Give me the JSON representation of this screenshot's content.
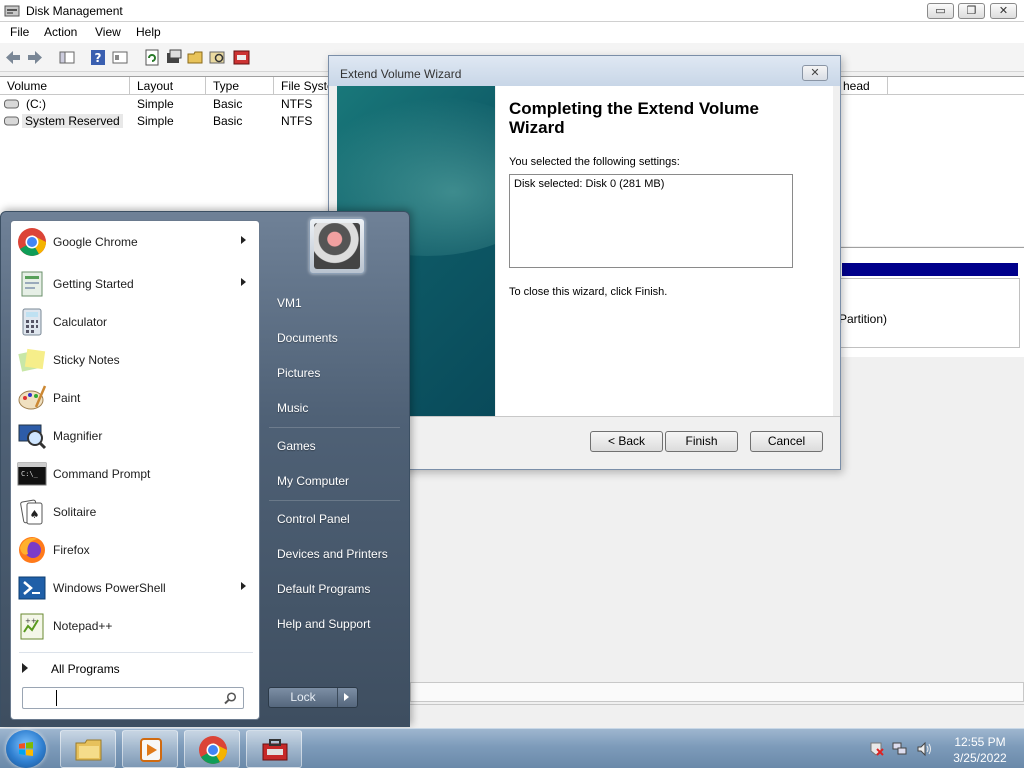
{
  "disk_management": {
    "title": "Disk Management",
    "window_controls": {
      "minimize": "▭",
      "maximize": "❐",
      "close": "✕"
    },
    "menu": [
      "File",
      "Action",
      "View",
      "Help"
    ],
    "columns": [
      "Volume",
      "Layout",
      "Type",
      "File Syste",
      "head"
    ],
    "volumes": [
      {
        "volume": "(C:)",
        "layout": "Simple",
        "type": "Basic",
        "fs": "NTFS"
      },
      {
        "volume": "System Reserved",
        "layout": "Simple",
        "type": "Basic",
        "fs": "NTFS"
      }
    ],
    "partition_label": "Partition)"
  },
  "wizard": {
    "title": "Extend Volume Wizard",
    "close_label": "✕",
    "heading": "Completing the Extend Volume Wizard",
    "settings_label": "You selected the following settings:",
    "settings_text": "Disk selected: Disk 0 (281 MB)",
    "close_instruction": "To close this wizard, click Finish.",
    "buttons": {
      "back": "< Back",
      "finish": "Finish",
      "cancel": "Cancel"
    }
  },
  "start_menu": {
    "programs": [
      {
        "label": "Google Chrome",
        "icon": "chrome-icon",
        "submenu": true
      },
      {
        "label": "Getting Started",
        "icon": "getting-started-icon",
        "submenu": true
      },
      {
        "label": "Calculator",
        "icon": "calculator-icon",
        "submenu": false
      },
      {
        "label": "Sticky Notes",
        "icon": "sticky-notes-icon",
        "submenu": false
      },
      {
        "label": "Paint",
        "icon": "paint-icon",
        "submenu": false
      },
      {
        "label": "Magnifier",
        "icon": "magnifier-icon",
        "submenu": false
      },
      {
        "label": "Command Prompt",
        "icon": "command-prompt-icon",
        "submenu": false
      },
      {
        "label": "Solitaire",
        "icon": "solitaire-icon",
        "submenu": false
      },
      {
        "label": "Firefox",
        "icon": "firefox-icon",
        "submenu": false
      },
      {
        "label": "Windows PowerShell",
        "icon": "powershell-icon",
        "submenu": true
      },
      {
        "label": "Notepad++",
        "icon": "notepadpp-icon",
        "submenu": false
      }
    ],
    "all_programs": "All Programs",
    "search_value": "",
    "right_items": [
      "VM1",
      "Documents",
      "Pictures",
      "Music",
      "Games",
      "My Computer",
      "Control Panel",
      "Devices and Printers",
      "Default Programs",
      "Help and Support"
    ],
    "lock_label": "Lock"
  },
  "taskbar": {
    "time": "12:55 PM",
    "date": "3/25/2022",
    "buttons": [
      "file-explorer-icon",
      "media-player-icon",
      "chrome-icon",
      "toolbox-icon"
    ]
  }
}
